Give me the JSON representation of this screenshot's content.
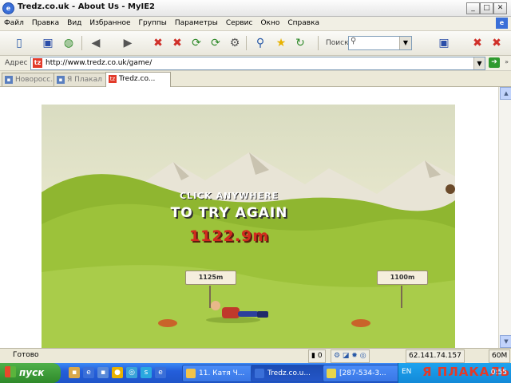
{
  "window": {
    "title": "Tredz.co.uk - About Us - MyIE2",
    "app_icon_letter": "e"
  },
  "menu": {
    "items": [
      "Файл",
      "Правка",
      "Вид",
      "Избранное",
      "Группы",
      "Параметры",
      "Сервис",
      "Окно",
      "Справка"
    ]
  },
  "toolbar": {
    "search_label": "Поиск",
    "search_value": ""
  },
  "address": {
    "label": "Адрес",
    "url": "http://www.tredz.co.uk/game/"
  },
  "tabs": [
    {
      "label": "Новоросс..."
    },
    {
      "label": "Я Плакал"
    },
    {
      "label": "Tredz.co..."
    }
  ],
  "game": {
    "click_anywhere": "CLICK ANYWHERE",
    "try_again": "TO TRY AGAIN",
    "distance": "1122.9m",
    "markers": [
      "1125m",
      "1100m"
    ]
  },
  "status": {
    "text": "Готово",
    "count": "0",
    "ip": "62.141.74.157",
    "memory": "60M"
  },
  "taskbar": {
    "start_label": "пуск",
    "tasks": [
      {
        "label": "11. Катя Ч...",
        "color": "#f2c34a"
      },
      {
        "label": "Tredz.co.u...",
        "color": "#3a6fd8"
      },
      {
        "label": "[287-534-3...",
        "color": "#e8d54a"
      }
    ],
    "lang": "EN",
    "watermark": "Я ПЛАКАЛЬ",
    "clock": "0:55"
  },
  "colors": {
    "accent": "#245edb",
    "start_green": "#3a9a35",
    "distance_red": "#d22a1e"
  }
}
